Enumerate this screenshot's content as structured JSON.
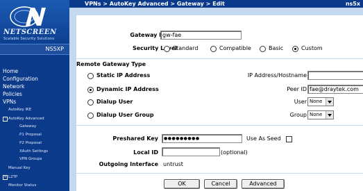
{
  "header": {
    "breadcrumb": "VPNs > AutoKey Advanced > Gateway > Edit",
    "device": "ns5x"
  },
  "sidebar": {
    "brand": "NETSCREEN",
    "brand_tagline": "Scalable Security Solutions",
    "model": "NS5XP",
    "items": [
      {
        "label": "Home"
      },
      {
        "label": "Configuration"
      },
      {
        "label": "Network"
      },
      {
        "label": "Policies"
      },
      {
        "label": "VPNs"
      },
      {
        "label": "AutoKey IKE"
      },
      {
        "label": "AutoKey Advanced"
      },
      {
        "label": "Gateway"
      },
      {
        "label": "P1 Proposal"
      },
      {
        "label": "P2 Proposal"
      },
      {
        "label": "XAuth Settings"
      },
      {
        "label": "VPN Groups"
      },
      {
        "label": "Manual Key"
      },
      {
        "label": "L2TP"
      },
      {
        "label": "Monitor Status"
      }
    ]
  },
  "form": {
    "gateway_name_label": "Gateway Name",
    "gateway_name_value": "gw-fae",
    "security_level_label": "Security Level",
    "security_levels": [
      "Standard",
      "Compatible",
      "Basic",
      "Custom"
    ],
    "security_level_selected": "Custom",
    "remote_section_title": "Remote Gateway Type",
    "remote_types": [
      "Static IP Address",
      "Dynamic IP Address",
      "Dialup User",
      "Dialup User Group"
    ],
    "remote_type_selected": "Dynamic IP Address",
    "ip_label": "IP Address/Hostname",
    "ip_value": "",
    "peer_id_label": "Peer ID",
    "peer_id_value": "fae@draytek.com",
    "user_label": "User",
    "user_value": "None",
    "group_label": "Group",
    "group_value": "None",
    "preshared_label": "Preshared Key",
    "preshared_value": "●●●●●●●●●",
    "use_as_seed_label": "Use As Seed",
    "local_id_label": "Local ID",
    "local_id_value": "",
    "optional_hint": "(optional)",
    "outgoing_label": "Outgoing Interface",
    "outgoing_value": "untrust"
  },
  "buttons": {
    "ok": "OK",
    "cancel": "Cancel",
    "advanced": "Advanced"
  },
  "colors": {
    "nav_bg": "#0b3a8a",
    "panel_bg": "#c4d8f0"
  }
}
